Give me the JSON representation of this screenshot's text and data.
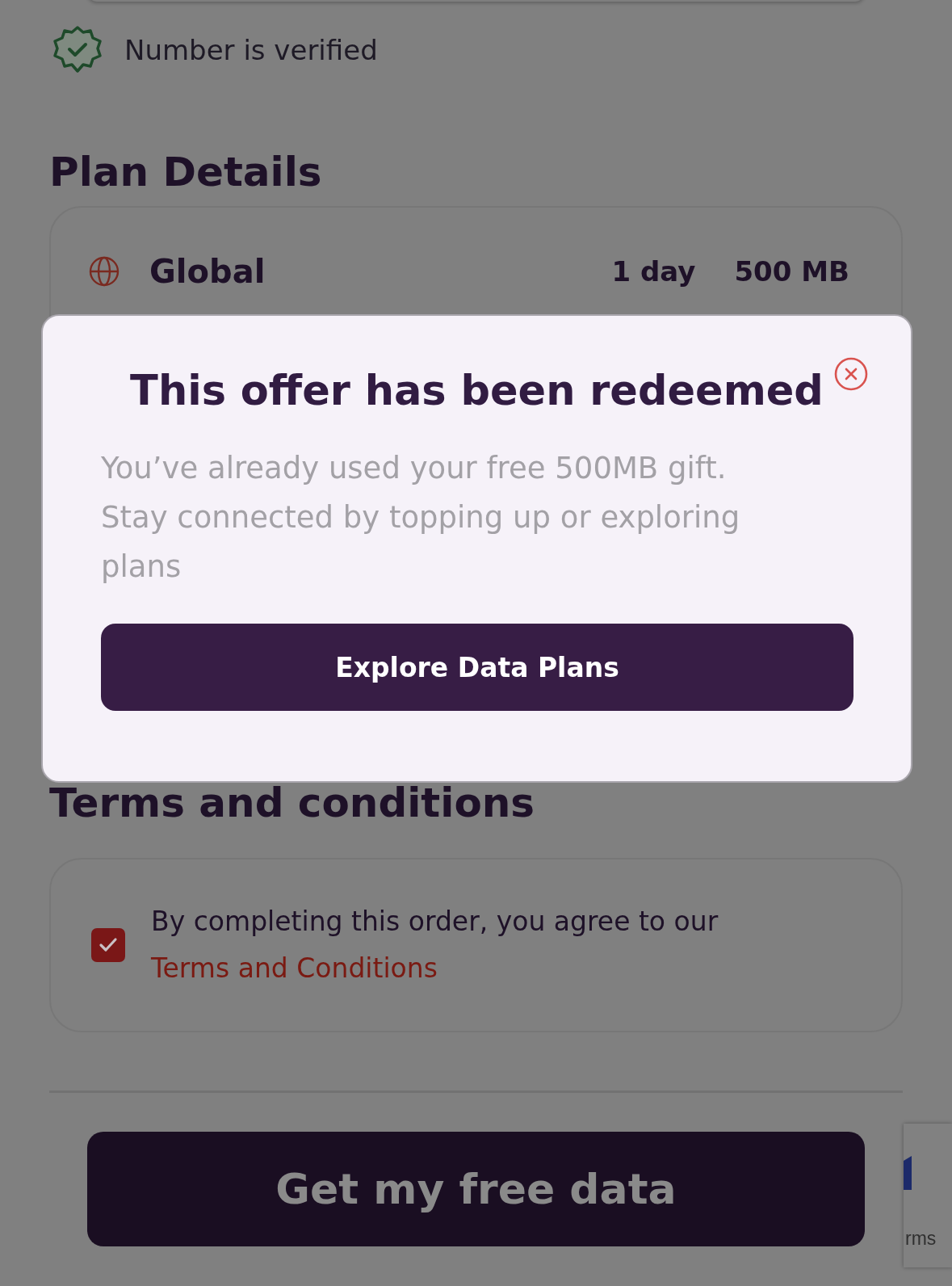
{
  "verification": {
    "label": "Number is verified"
  },
  "plan_details": {
    "heading": "Plan Details",
    "plan": {
      "name": "Global",
      "duration": "1 day",
      "data": "500 MB"
    }
  },
  "terms": {
    "heading": "Terms and conditions",
    "agreement": {
      "text": "By completing this order, you agree to our",
      "link": "Terms and Conditions",
      "checked": true
    }
  },
  "primary_button": {
    "label": "Get my free data"
  },
  "badge": {
    "text": "rms"
  },
  "modal": {
    "title": "This offer has been redeemed",
    "message": "You’ve already used your free 500MB gift. Stay connected by topping up or exploring plans",
    "button": "Explore Data Plans"
  }
}
